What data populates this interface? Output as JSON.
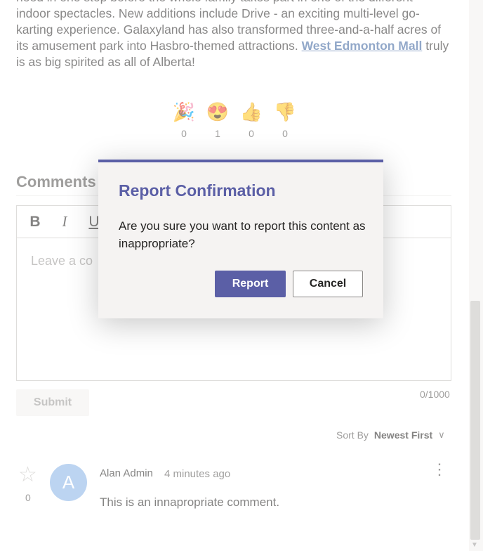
{
  "article": {
    "line1": "need in one stop before the whole family takes part in one of the different",
    "line2": "indoor spectacles. New additions include Drive - an exciting multi-level go-",
    "line3": "karting experience. Galaxyland has also transformed three-and-a-half acres of",
    "line4_pre": "its amusement park into Hasbro-themed attractions. ",
    "link_text": "West Edmonton Mall",
    "line4_post": " truly",
    "line5": "is as big spirited as all of Alberta!"
  },
  "reactions": [
    {
      "icon": "party-popper-icon",
      "glyph": "🎉",
      "count": "0"
    },
    {
      "icon": "heart-eyes-icon",
      "glyph": "😍",
      "count": "1"
    },
    {
      "icon": "thumbs-up-icon",
      "glyph": "👍",
      "count": "0"
    },
    {
      "icon": "thumbs-down-icon",
      "glyph": "👎",
      "count": "0"
    }
  ],
  "comments": {
    "title": "Comments (",
    "editor": {
      "bold": "B",
      "italic": "I",
      "underline": "U",
      "placeholder": "Leave a co"
    },
    "counter": "0/1000",
    "submit": "Submit",
    "sort_label": "Sort By",
    "sort_value": "Newest First",
    "items": [
      {
        "star_count": "0",
        "avatar_initial": "A",
        "author": "Alan Admin",
        "time": "4 minutes ago",
        "text": "This is an innapropriate comment."
      }
    ]
  },
  "dialog": {
    "title": "Report Confirmation",
    "message": "Are you sure you want to report this content as inappropriate?",
    "confirm_label": "Report",
    "cancel_label": "Cancel"
  },
  "colors": {
    "accent": "#5b5fa6",
    "link": "#4a6fa5",
    "avatar": "#8fb8e8"
  }
}
